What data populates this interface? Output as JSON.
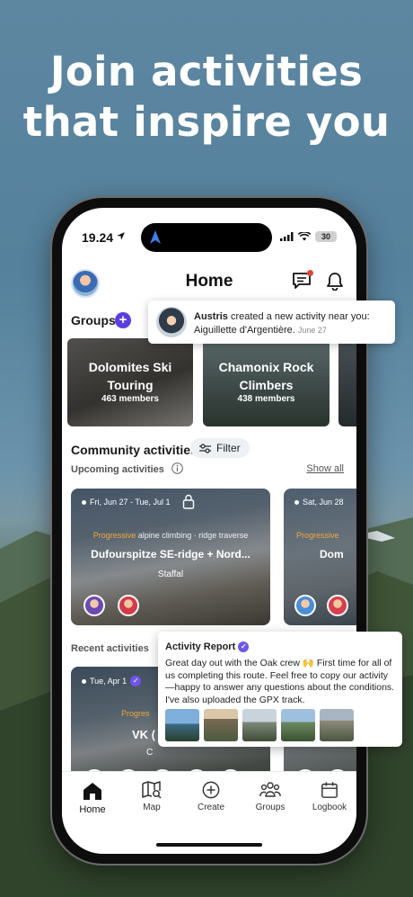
{
  "headline": {
    "line1": "Join activities",
    "line2": "that inspire you"
  },
  "status_bar": {
    "time": "19.24",
    "battery": "30"
  },
  "header": {
    "title": "Home",
    "chat_icon": "chat-bubble-icon",
    "bell_icon": "bell-icon"
  },
  "groups": {
    "section_title": "Groups",
    "items": [
      {
        "name": "Dolomites Ski Touring",
        "members": "463 members"
      },
      {
        "name": "Chamonix Rock Climbers",
        "members": "438 members"
      }
    ]
  },
  "community": {
    "section_title": "Community activities",
    "filter_label": "Filter",
    "upcoming_label": "Upcoming activities",
    "show_all": "Show all",
    "upcoming": [
      {
        "date": "Fri, Jun 27 - Tue, Jul 1",
        "level": "Progressive",
        "type": " alpine climbing · ridge traverse",
        "title": "Dufourspitze SE-ridge + Nord...",
        "place": "Staffal"
      },
      {
        "date": "Sat, Jun 28",
        "level": "Progressive",
        "title": "Dom"
      }
    ],
    "recent_label": "Recent activities",
    "recent": [
      {
        "date": "Tue, Apr 1",
        "level": "Progres",
        "title": "VK (",
        "place": "C"
      }
    ]
  },
  "notification": {
    "user": "Austris",
    "text": " created a new activity near you: Aiguillette d'Argentière.",
    "time": "June 27"
  },
  "activity_report": {
    "title": "Activity Report",
    "body": "Great day out with the Oak crew 🙌 First time for all of us completing this route. Feel free to copy our activity—happy to answer any questions about the conditions. I've also uploaded the GPX track."
  },
  "tabbar": {
    "tabs": [
      {
        "label": "Home",
        "icon": "home-icon"
      },
      {
        "label": "Map",
        "icon": "map-icon"
      },
      {
        "label": "Create",
        "icon": "plus-circle-icon"
      },
      {
        "label": "Groups",
        "icon": "groups-icon"
      },
      {
        "label": "Logbook",
        "icon": "calendar-icon"
      }
    ]
  },
  "colors": {
    "accent": "#5b3ee0",
    "level": "#f3a83a",
    "verified": "#6f56e8"
  }
}
